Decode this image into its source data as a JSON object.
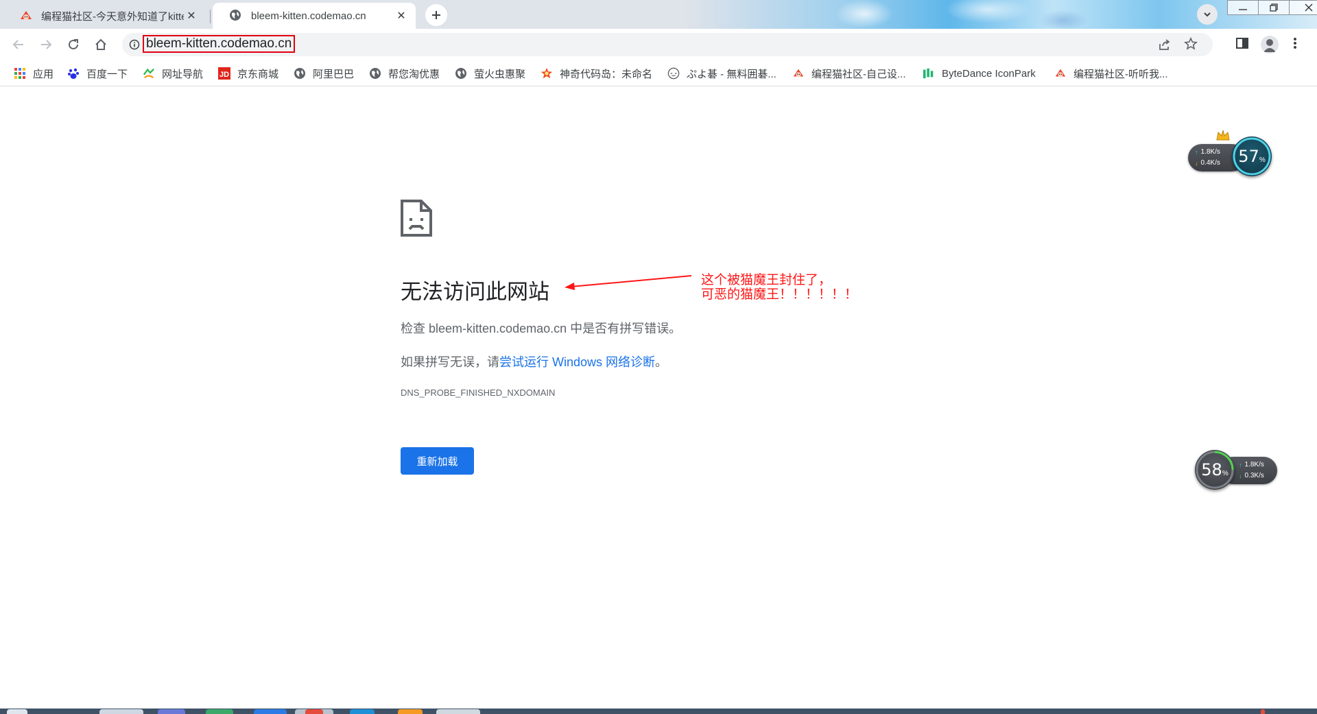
{
  "tabs": [
    {
      "title": "编程猫社区-今天意外知道了kitten",
      "active": false
    },
    {
      "title": "bleem-kitten.codemao.cn",
      "active": true
    }
  ],
  "toolbar": {
    "url": "bleem-kitten.codemao.cn"
  },
  "bookmarks": [
    {
      "label": "应用",
      "icon": "apps-grid-icon"
    },
    {
      "label": "百度一下",
      "icon": "baidu-paw-icon"
    },
    {
      "label": "网址导航",
      "icon": "nav-site-icon"
    },
    {
      "label": "京东商城",
      "icon": "jd-logo-icon"
    },
    {
      "label": "阿里巴巴",
      "icon": "globe-icon"
    },
    {
      "label": "帮您淘优惠",
      "icon": "globe-icon"
    },
    {
      "label": "萤火虫惠聚",
      "icon": "globe-icon"
    },
    {
      "label": "神奇代码岛：未命名",
      "icon": "code-island-icon"
    },
    {
      "label": "ぷよ碁 - 無料囲碁...",
      "icon": "puyo-face-icon"
    },
    {
      "label": "编程猫社区-自己设...",
      "icon": "codemao-icon"
    },
    {
      "label": "ByteDance IconPark",
      "icon": "iconpark-icon"
    },
    {
      "label": "编程猫社区-听听我...",
      "icon": "codemao-icon"
    }
  ],
  "error": {
    "title": "无法访问此网站",
    "check_prefix": "检查 ",
    "check_host": "bleem-kitten.codemao.cn",
    "check_suffix": " 中是否有拼写错误。",
    "suggest_prefix": "如果拼写无误，请",
    "suggest_link": "尝试运行 Windows 网络诊断",
    "suggest_suffix": "。",
    "code": "DNS_PROBE_FINISHED_NXDOMAIN",
    "reload_label": "重新加载"
  },
  "annotation": {
    "line1": "这个被猫魔王封住了，",
    "line2": "可恶的猫魔王！！！！！！",
    "color": "#ff1515"
  },
  "net_widget_top": {
    "upload": "1.8",
    "download": "0.4",
    "unit": "K/s",
    "percent": "57",
    "percent_sign": "%"
  },
  "net_widget_bottom": {
    "upload": "1.8",
    "download": "0.3",
    "unit": "K/s",
    "percent": "58",
    "percent_sign": "%"
  },
  "colors": {
    "accent": "#1a73e8",
    "annotation_red": "#ff1515",
    "url_highlight": "#e3000f"
  }
}
